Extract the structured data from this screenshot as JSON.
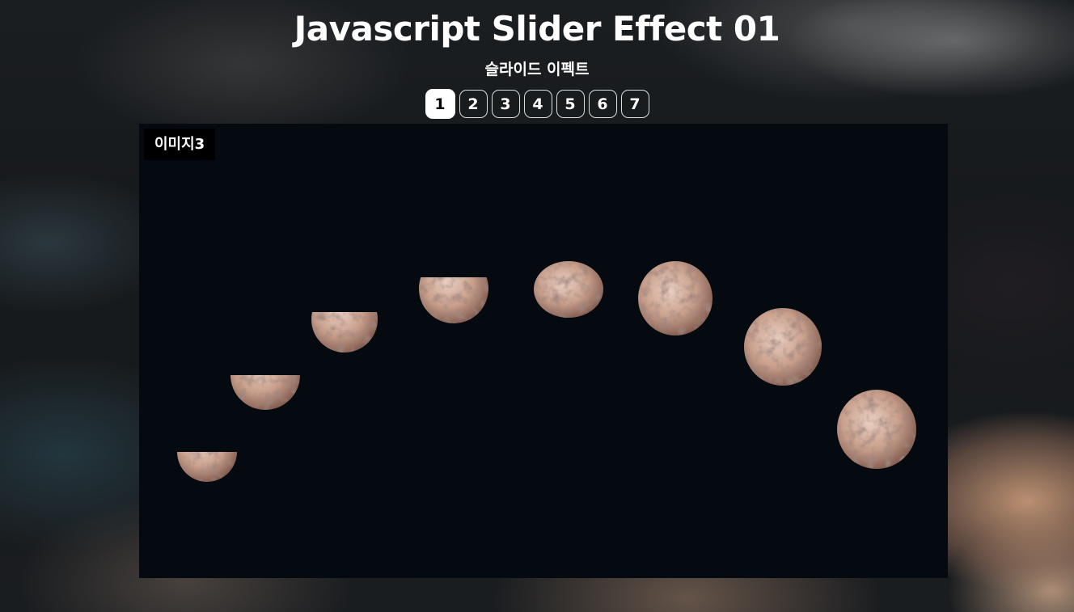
{
  "header": {
    "title": "Javascript Slider Effect 01",
    "subtitle": "슬라이드 이펙트"
  },
  "pagination": {
    "active_index": 0,
    "items": [
      "1",
      "2",
      "3",
      "4",
      "5",
      "6",
      "7"
    ]
  },
  "slide": {
    "label": "이미지3",
    "image_subject": "moon phases arc on night sky"
  },
  "colors": {
    "slide_background": "#040a0f",
    "moon_light": "#d9b9a8",
    "moon_shadow": "#6e4f45",
    "active_dot": "#ffffff"
  }
}
